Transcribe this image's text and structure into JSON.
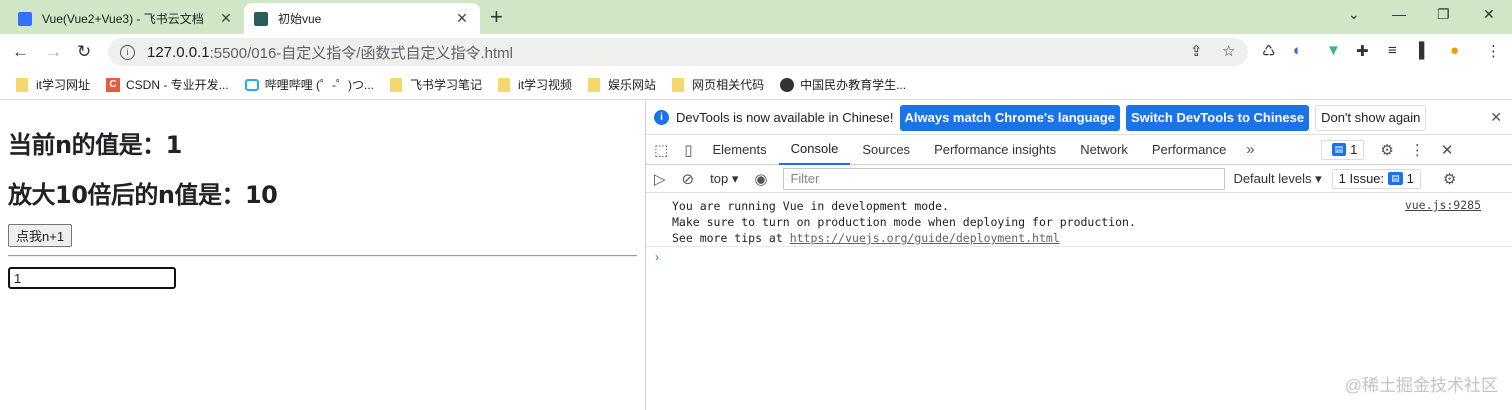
{
  "browser": {
    "tabs": [
      {
        "title": "Vue(Vue2+Vue3) - 飞书云文档",
        "close": "✕"
      },
      {
        "title": "初始vue",
        "close": "✕"
      }
    ],
    "new_tab": "+",
    "url_host": "127.0.0.1",
    "url_path": ":5500/016-自定义指令/函数式自定义指令.html",
    "bookmarks": [
      {
        "label": "it学习网址",
        "icon": "folder-icon"
      },
      {
        "label": "CSDN - 专业开发...",
        "icon": "csdn-icon"
      },
      {
        "label": "哔哩哔哩 (゜-゜)つ...",
        "icon": "bilibili-icon"
      },
      {
        "label": "飞书学习笔记",
        "icon": "folder-icon"
      },
      {
        "label": "it学习视频",
        "icon": "folder-icon"
      },
      {
        "label": "娱乐网站",
        "icon": "folder-icon"
      },
      {
        "label": "网页相关代码",
        "icon": "folder-icon"
      },
      {
        "label": "中国民办教育学生...",
        "icon": "globe-icon"
      }
    ]
  },
  "page": {
    "heading1": "当前n的值是：1",
    "heading2": "放大10倍后的n值是：10",
    "button": "点我n+1",
    "input_value": "1"
  },
  "devtools": {
    "banner_text": "DevTools is now available in Chinese!",
    "banner_btn1": "Always match Chrome's language",
    "banner_btn2": "Switch DevTools to Chinese",
    "banner_btn3": "Don't show again",
    "tabs": [
      "Elements",
      "Console",
      "Sources",
      "Performance insights",
      "Network",
      "Performance"
    ],
    "issue_count": "1",
    "context": "top",
    "filter_placeholder": "Filter",
    "levels": "Default levels",
    "issues_label": "1 Issue:",
    "msg_line1": "You are running Vue in development mode.",
    "msg_line2": "Make sure to turn on production mode when deploying for production.",
    "msg_line3_prefix": "See more tips at ",
    "msg_link": "https://vuejs.org/guide/deployment.html",
    "msg_source": "vue.js:9285"
  },
  "watermark": "@稀土掘金技术社区"
}
